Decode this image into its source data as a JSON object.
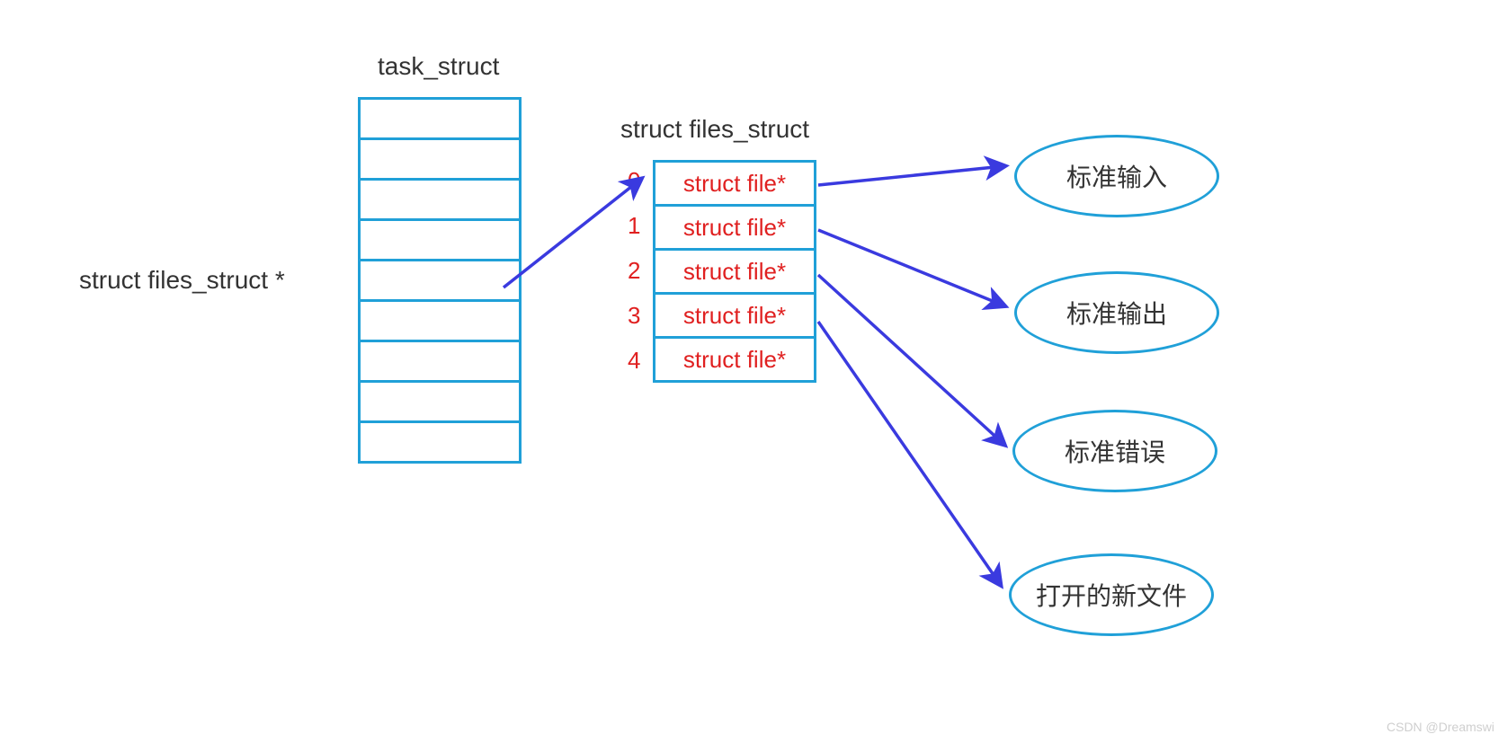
{
  "labels": {
    "task_struct_title": "task_struct",
    "files_struct_title": "struct files_struct",
    "pointer_label": "struct files_struct  *"
  },
  "fd_table": {
    "indices": [
      "0",
      "1",
      "2",
      "3",
      "4"
    ],
    "entries": [
      "struct file*",
      "struct file*",
      "struct file*",
      "struct file*",
      "struct file*"
    ]
  },
  "targets": {
    "stdin": "标准输入",
    "stdout": "标准输出",
    "stderr": "标准错误",
    "newfile": "打开的新文件"
  },
  "colors": {
    "border": "#20a0d8",
    "text_red": "#e02020",
    "arrow": "#3a3adf"
  },
  "watermark": "CSDN @Dreamswi"
}
